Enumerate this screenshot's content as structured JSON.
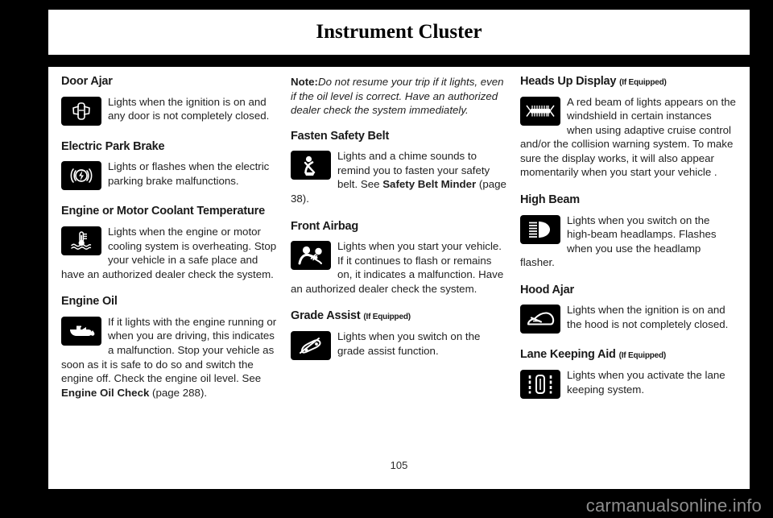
{
  "header": {
    "title": "Instrument Cluster"
  },
  "footer": {
    "page_number": "105",
    "watermark": "carmanualsonline.info"
  },
  "columns": [
    {
      "blocks": [
        {
          "heading": "Door Ajar",
          "optional": "",
          "icon": "door-ajar-icon",
          "text_segments": [
            {
              "type": "plain",
              "text": "Lights when the ignition is on and any door is not completely closed."
            }
          ]
        },
        {
          "heading": "Electric Park Brake",
          "optional": "",
          "icon": "electric-park-brake-icon",
          "text_segments": [
            {
              "type": "plain",
              "text": "Lights or flashes when the electric parking brake malfunctions."
            }
          ]
        },
        {
          "heading": "Engine or Motor Coolant Temperature",
          "optional": "",
          "icon": "coolant-temperature-icon",
          "text_segments": [
            {
              "type": "plain",
              "text": "Lights when the engine or motor cooling system is overheating. Stop your vehicle in a safe place and have an authorized dealer check the system."
            }
          ]
        },
        {
          "heading": "Engine Oil",
          "optional": "",
          "icon": "engine-oil-icon",
          "text_segments": [
            {
              "type": "plain",
              "text": "If it lights with the engine running or when you are driving, this indicates a malfunction. Stop your vehicle as soon as it is safe to do so and switch the engine off. Check the engine oil level.  See "
            },
            {
              "type": "bold",
              "text": "Engine Oil Check"
            },
            {
              "type": "plain",
              "text": " (page 288)."
            }
          ]
        }
      ]
    },
    {
      "note": {
        "label": "Note:",
        "text": "Do not resume your trip if it lights, even if the oil level is correct. Have an authorized dealer check the system immediately."
      },
      "blocks": [
        {
          "heading": "Fasten Safety Belt",
          "optional": "",
          "icon": "safety-belt-icon",
          "text_segments": [
            {
              "type": "plain",
              "text": "Lights and a chime sounds to remind you to fasten your safety belt. See "
            },
            {
              "type": "bold",
              "text": "Safety Belt Minder"
            },
            {
              "type": "plain",
              "text": " (page 38)."
            }
          ]
        },
        {
          "heading": "Front Airbag",
          "optional": "",
          "icon": "front-airbag-icon",
          "text_segments": [
            {
              "type": "plain",
              "text": "Lights when you start your vehicle. If it continues to flash or remains on, it indicates a malfunction. Have an authorized dealer check the system."
            }
          ]
        },
        {
          "heading": "Grade Assist",
          "optional": "(If Equipped)",
          "icon": "grade-assist-icon",
          "text_segments": [
            {
              "type": "plain",
              "text": "Lights when you switch on the grade assist function."
            }
          ]
        }
      ]
    },
    {
      "blocks": [
        {
          "heading": "Heads Up Display",
          "optional": "(If Equipped)",
          "icon": "heads-up-display-icon",
          "text_segments": [
            {
              "type": "plain",
              "text": "A red beam of lights appears on the windshield in certain instances when using adaptive cruise control and/or the collision warning system. To make sure the display works, it will also appear momentarily when you start your vehicle ."
            }
          ]
        },
        {
          "heading": "High Beam",
          "optional": "",
          "icon": "high-beam-icon",
          "text_segments": [
            {
              "type": "plain",
              "text": "Lights when you switch on the high-beam headlamps. Flashes when you use the headlamp flasher."
            }
          ]
        },
        {
          "heading": "Hood Ajar",
          "optional": "",
          "icon": "hood-ajar-icon",
          "text_segments": [
            {
              "type": "plain",
              "text": "Lights when the ignition is on and the hood is not completely closed."
            }
          ]
        },
        {
          "heading": "Lane Keeping Aid",
          "optional": "(If Equipped)",
          "icon": "lane-keeping-aid-icon",
          "text_segments": [
            {
              "type": "plain",
              "text": "Lights when you activate the lane keeping system."
            }
          ]
        }
      ]
    }
  ],
  "colors": {
    "page_background": "#ffffff",
    "outer_background": "#000000",
    "icon_background": "#000000",
    "text": "#1f1f1f",
    "watermark": "#8e8e8e"
  }
}
